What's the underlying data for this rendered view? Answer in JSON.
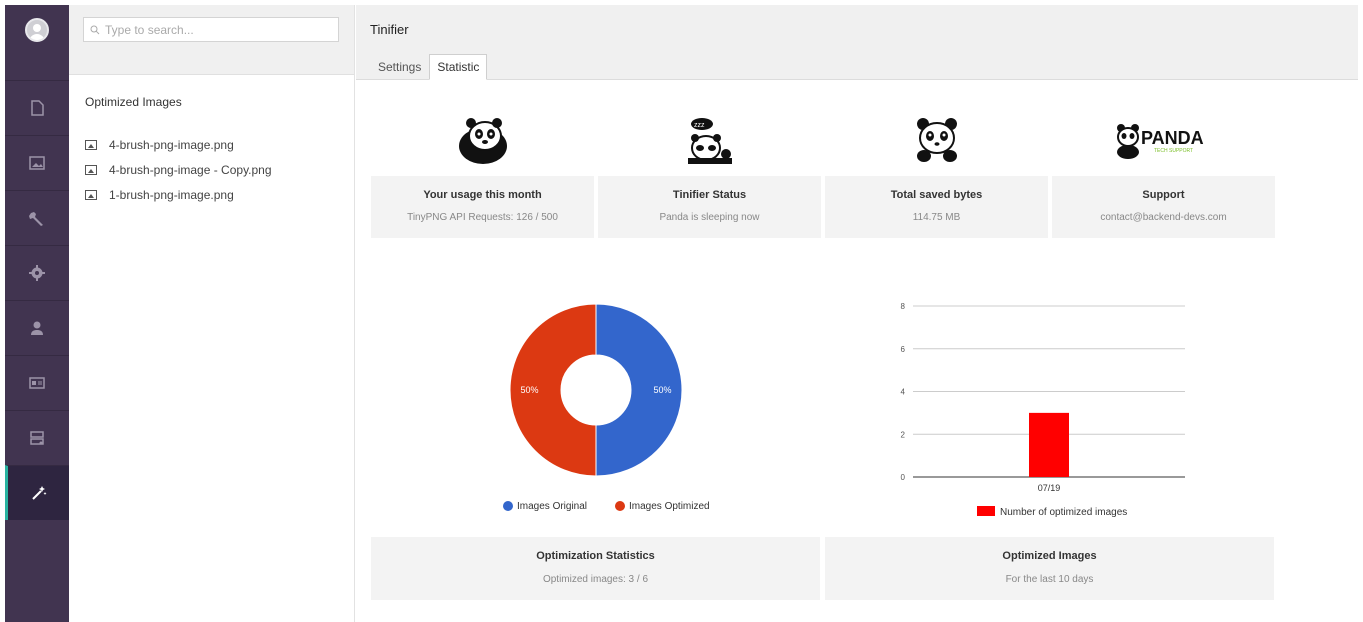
{
  "search": {
    "placeholder": "Type to search..."
  },
  "sidepanel": {
    "title": "Optimized Images",
    "files": [
      "4-brush-png-image.png",
      "4-brush-png-image - Copy.png",
      "1-brush-png-image.png"
    ]
  },
  "main": {
    "title": "Tinifier",
    "tabs": [
      {
        "label": "Settings"
      },
      {
        "label": "Statistic"
      }
    ],
    "active_tab": "Statistic"
  },
  "cards": [
    {
      "title": "Your usage this month",
      "value": "TinyPNG API Requests: 126 / 500",
      "icon": "panda-icon"
    },
    {
      "title": "Tinifier Status",
      "value": "Panda is sleeping now",
      "icon": "sleeping-panda-icon"
    },
    {
      "title": "Total saved bytes",
      "value": "114.75 MB",
      "icon": "panda-face-icon"
    },
    {
      "title": "Support",
      "value": "contact@backend-devs.com",
      "icon": "panda-logo-icon",
      "logo_text": "PANDA",
      "logo_sub": "TECH SUPPORT"
    }
  ],
  "donut_card": {
    "title": "Optimization Statistics",
    "value": "Optimized images: 3 / 6"
  },
  "bar_card": {
    "title": "Optimized Images",
    "value": "For the last 10 days"
  },
  "chart_data": [
    {
      "type": "pie",
      "labels": [
        "Images Original",
        "Images Optimized"
      ],
      "values": [
        50,
        50
      ],
      "slice_labels": [
        "50%",
        "50%"
      ],
      "colors": [
        "#3366cc",
        "#dc3912"
      ],
      "legend": "bottom"
    },
    {
      "type": "bar",
      "categories": [
        "07/19"
      ],
      "series": [
        {
          "name": "Number of optimized images",
          "values": [
            3
          ]
        }
      ],
      "yticks": [
        "0",
        "2",
        "4",
        "6",
        "8"
      ],
      "ylim": [
        0,
        8
      ],
      "color": "#ff0000",
      "legend": "bottom",
      "grid": true
    }
  ]
}
